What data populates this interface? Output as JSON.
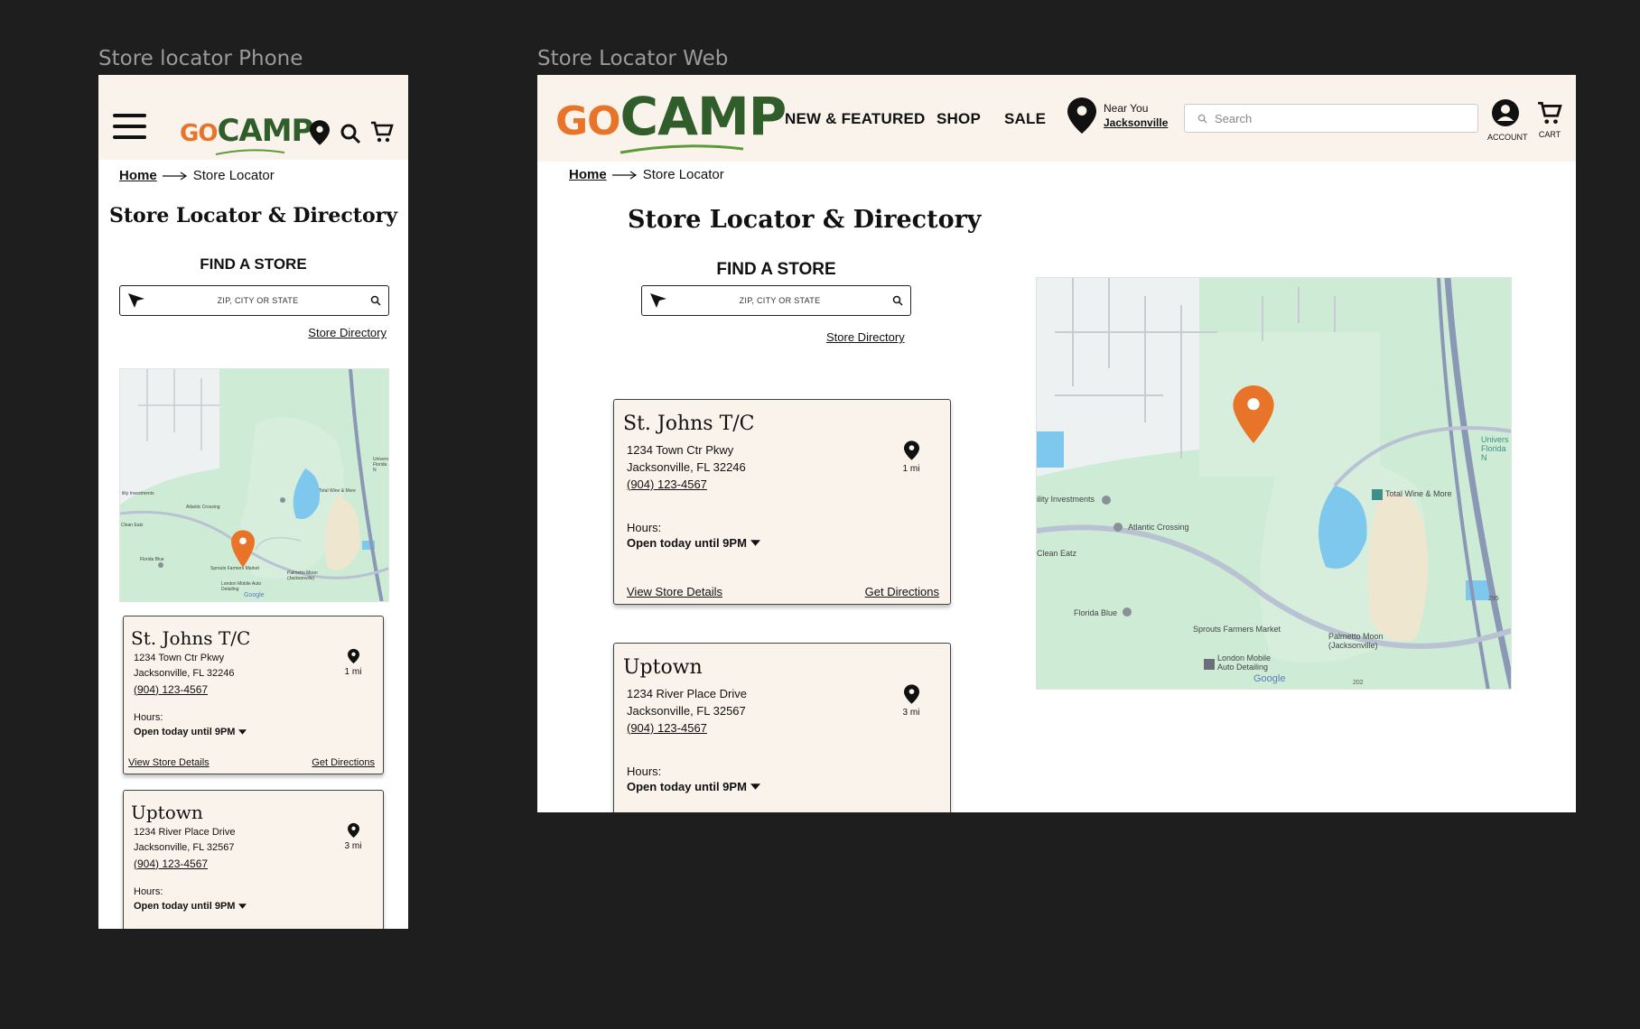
{
  "frames": {
    "phone_label": "Store locator Phone",
    "web_label": "Store Locator Web"
  },
  "brand": {
    "go": "GO",
    "camp": "CAMP",
    "go_color": "#e8742a",
    "camp_color": "#2f5e2a"
  },
  "breadcrumb": {
    "home": "Home",
    "current": "Store Locator"
  },
  "page": {
    "title": "Store Locator & Directory",
    "find_heading": "FIND A STORE",
    "search_placeholder": "ZIP, CITY OR STATE",
    "directory_link": "Store Directory"
  },
  "web_header": {
    "nav": [
      "NEW & FEATURED",
      "SHOP",
      "SALE"
    ],
    "near_label": "Near You",
    "near_city": "Jacksonville",
    "search_placeholder": "Search",
    "account_label": "ACCOUNT",
    "cart_label": "CART"
  },
  "hours_label": "Hours:",
  "hours_value": "Open today until 9PM",
  "details_link": "View Store Details",
  "directions_link": "Get Directions",
  "stores": [
    {
      "name": "St. Johns T/C",
      "street": "1234 Town Ctr Pkwy",
      "city": "Jacksonville, FL 32246",
      "phone": "(904) 123-4567",
      "distance": "1 mi"
    },
    {
      "name": "Uptown",
      "street": "1234 River Place Drive",
      "city": "Jacksonville, FL 32567",
      "phone": "(904) 123-4567",
      "distance": "3 mi"
    }
  ],
  "map_labels": {
    "total_wine": "Total Wine & More",
    "atlantic": "Atlantic Crossing",
    "investments": "ility Investments",
    "clean_eatz": "Clean Eatz",
    "florida_blue": "Florida Blue",
    "sprouts": "Sprouts Farmers Market",
    "palmetto": "Palmetto Moon (Jacksonville)",
    "london": "London Mobile Auto Detailing",
    "univ": "Univers Florida N",
    "google": "Google",
    "hwy295": "295",
    "hwy202": "202"
  },
  "colors": {
    "header_bg": "#faf3ec",
    "pin_orange": "#e8742a",
    "map_green": "#cdebd5",
    "water": "#7ec8ee"
  }
}
